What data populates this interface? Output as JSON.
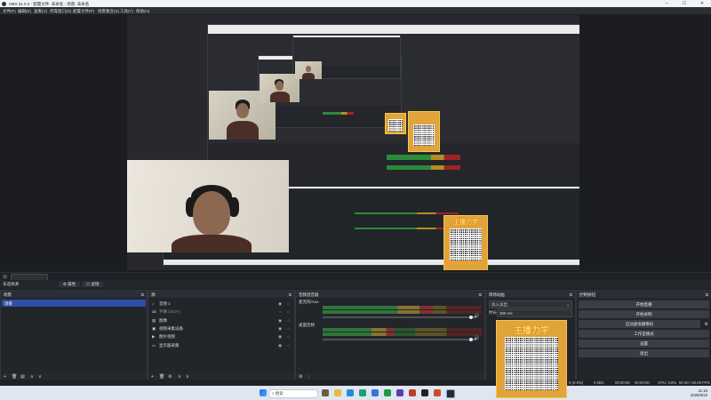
{
  "window": {
    "title": "OBS 31.0.2 - 配置文件: 未命名 - 场景: 未命名",
    "minimize": "–",
    "maximize": "☐",
    "close": "✕"
  },
  "menu": [
    "文件(F)",
    "编辑(E)",
    "查看(V)",
    "停靠窗口(D)",
    "配置文件(P)",
    "场景集合(S)",
    "工具(T)",
    "帮助(H)"
  ],
  "source_toolbar": {
    "no_source_label": "未选择源",
    "properties_label": "属性",
    "filters_label": "滤镜"
  },
  "docks": {
    "scenes": {
      "title": "场景",
      "items": [
        "场景"
      ]
    },
    "sources": {
      "title": "源",
      "items": [
        {
          "label": "音频 1",
          "icon": "speaker-icon"
        },
        {
          "label": "字幕 (GDI+)",
          "icon": "text-icon"
        },
        {
          "label": "图像",
          "icon": "image-icon"
        },
        {
          "label": "视频采集设备",
          "icon": "camera-icon"
        },
        {
          "label": "图片视频",
          "icon": "media-icon"
        },
        {
          "label": "显示器采集",
          "icon": "monitor-icon"
        }
      ]
    },
    "mixer": {
      "title": "音频混音器",
      "channels": [
        {
          "name": "麦克风/Aux",
          "level": 0.69,
          "volume": 0.97
        },
        {
          "name": "桌面音频",
          "level": 0.45,
          "volume": 0.97
        }
      ]
    },
    "transitions": {
      "title": "转场动画",
      "transition": "淡入淡出",
      "duration_label": "时长",
      "duration": "300 ms"
    },
    "controls": {
      "title": "控制按钮",
      "buttons": [
        "开始直播",
        "开始录制",
        "启动虚拟摄像机",
        "工作室模式",
        "设置",
        "退出"
      ]
    }
  },
  "status": {
    "cpu": "CPU: 0.8%",
    "fps": "60.00 / 60.00 FPS",
    "kbps": "0 kb/s",
    "time1": "00:00:00",
    "time2": "00:00:00",
    "drop": "0 (0.0%)"
  },
  "taskbar": {
    "search_placeholder": "搜索",
    "time": "11:15",
    "date": "2025/8/22"
  },
  "overlay": {
    "brand_text": "主播力学"
  }
}
